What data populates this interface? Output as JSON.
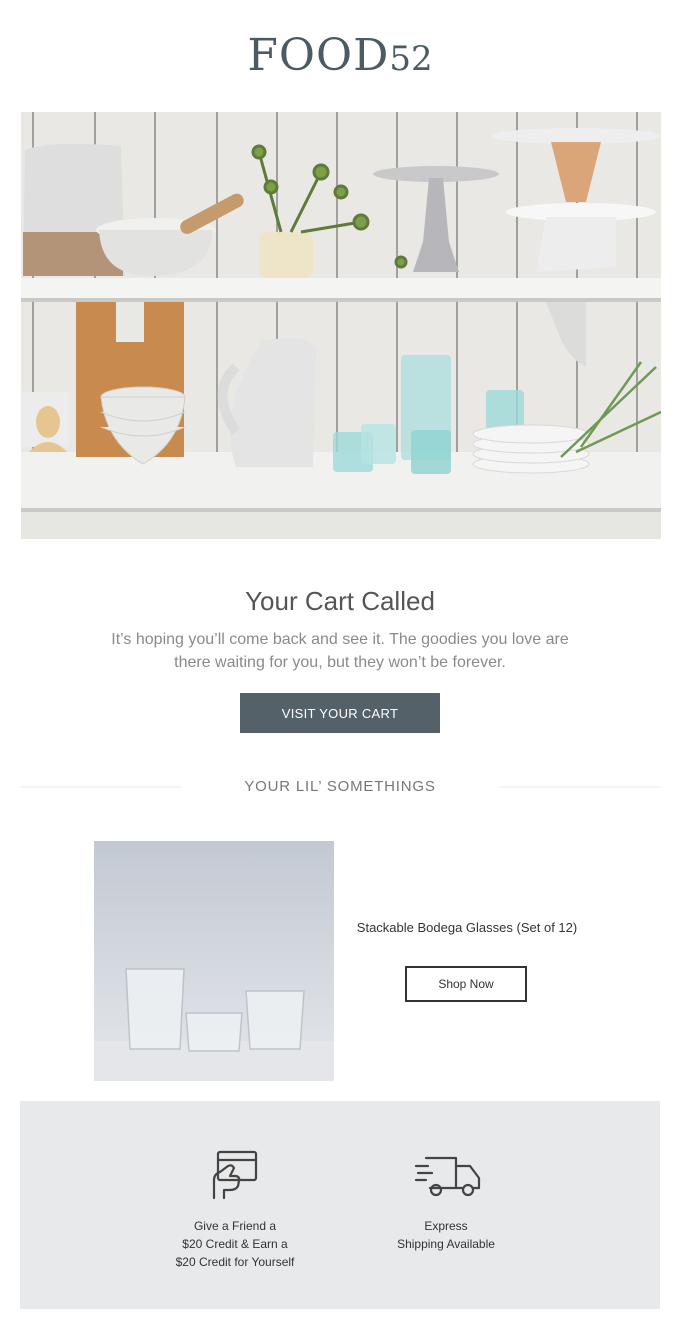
{
  "header": {
    "logo_word": "FOOD",
    "logo_num": "52"
  },
  "hero": {
    "image_name": "kitchen-shelves-photo"
  },
  "main": {
    "headline": "Your Cart Called",
    "subcopy": "It’s hoping you’ll come back and see it. The goodies you love are there waiting for you, but they won’t be forever.",
    "cta_label": "VISIT YOUR CART"
  },
  "cart_section": {
    "title": "YOUR LIL’ SOMETHINGS",
    "items": [
      {
        "name": "Stackable Bodega Glasses (Set of 12)",
        "button_label": "Shop Now"
      }
    ]
  },
  "footer": {
    "features": [
      {
        "icon": "gift-card-icon",
        "line1": "Give a Friend a",
        "line2": "$20 Credit & Earn a",
        "line3": "$20 Credit for Yourself"
      },
      {
        "icon": "delivery-truck-icon",
        "line1": "Express",
        "line2": "Shipping Available"
      }
    ]
  },
  "colors": {
    "brand": "#4c5b61",
    "cta_bg": "#546168",
    "footer_bg": "#e8e9ea"
  }
}
